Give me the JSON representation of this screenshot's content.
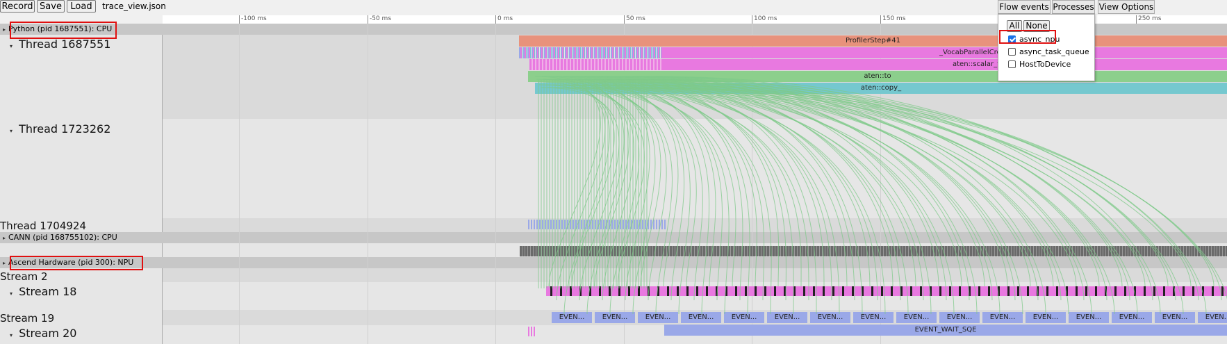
{
  "toolbar": {
    "record": "Record",
    "save": "Save",
    "load": "Load",
    "filename": "trace_view.json"
  },
  "ruler": {
    "ticks": [
      {
        "label": "-100 ms"
      },
      {
        "label": "-50 ms"
      },
      {
        "label": "0 ms"
      },
      {
        "label": "50 ms"
      },
      {
        "label": "100 ms"
      },
      {
        "label": "150 ms"
      },
      {
        "label": "250 ms"
      }
    ]
  },
  "processes": {
    "python": "Python (pid 1687551): CPU",
    "cann": "CANN (pid 168755102): CPU",
    "ascend": "Ascend Hardware (pid 300): NPU"
  },
  "threads": {
    "t1": "Thread 1687551",
    "t2": "Thread 1723262",
    "t3": "Thread 1704924",
    "s2": "Stream 2",
    "s18": "Stream 18",
    "s19": "Stream 19",
    "s20": "Stream 20"
  },
  "slices": {
    "profiler_step": "ProfilerStep#41",
    "vocab": "_VocabParallelCros",
    "scalar": "aten::scalar_ter",
    "to": "aten::to",
    "copy": "aten::copy_",
    "event_wait": "EVENT_WAIT_SQE",
    "event_short": "EVEN..."
  },
  "tabs": {
    "flow_events": "Flow events",
    "processes": "Processes",
    "view_options": "View Options"
  },
  "flow_panel": {
    "all": "All",
    "none": "None",
    "options": [
      {
        "label": "async_npu",
        "checked": true
      },
      {
        "label": "async_task_queue",
        "checked": false
      },
      {
        "label": "HostToDevice",
        "checked": false
      }
    ]
  },
  "colors": {
    "profiler_step": "#e8927c",
    "vocab": "#e879e0",
    "to": "#8ccf8c",
    "copy": "#75c8cf",
    "event": "#9aa8e8",
    "flow_arrow": "#7fc98a",
    "highlight": "#e01010"
  }
}
